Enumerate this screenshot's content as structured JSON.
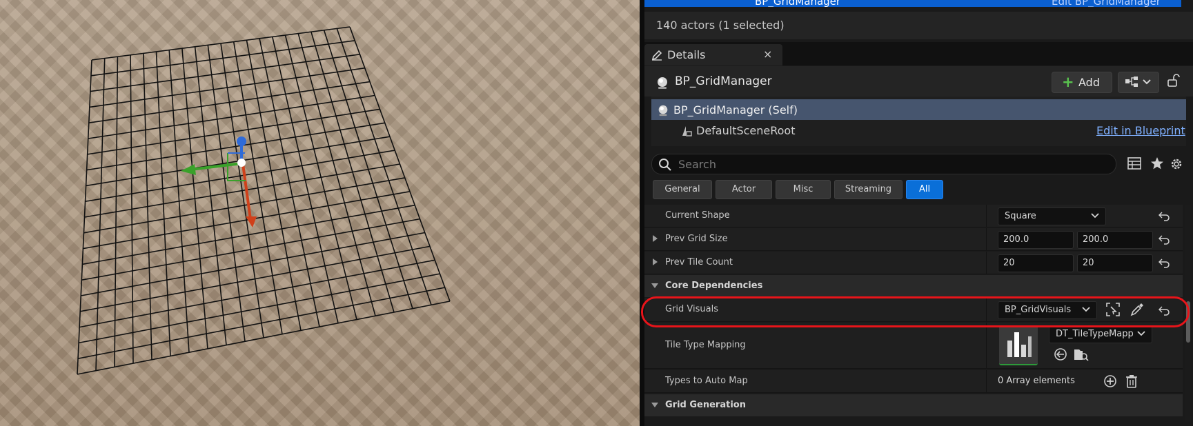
{
  "outliner": {
    "selected_actor": "BP_GridManager",
    "selected_edit": "Edit BP_GridManager",
    "actor_count": "140 actors (1 selected)"
  },
  "details": {
    "tab_label": "Details",
    "actor_name": "BP_GridManager",
    "add_label": "Add",
    "components": {
      "self": "BP_GridManager (Self)",
      "root": "DefaultSceneRoot",
      "edit_in_blueprint": "Edit in Blueprint"
    },
    "search_placeholder": "Search",
    "filters": [
      "General",
      "Actor",
      "Misc",
      "Streaming",
      "All"
    ],
    "active_filter": "All",
    "properties": {
      "current_shape": {
        "label": "Current Shape",
        "value": "Square"
      },
      "prev_grid_size": {
        "label": "Prev Grid Size",
        "x": "200.0",
        "y": "200.0"
      },
      "prev_tile_count": {
        "label": "Prev Tile Count",
        "x": "20",
        "y": "20"
      },
      "core_dependencies": "Core Dependencies",
      "grid_visuals": {
        "label": "Grid Visuals",
        "value": "BP_GridVisuals"
      },
      "tile_type_mapping": {
        "label": "Tile Type Mapping",
        "value": "DT_TileTypeMapp"
      },
      "types_to_auto_map": {
        "label": "Types to Auto Map",
        "value": "0 Array elements"
      },
      "grid_generation": "Grid Generation"
    }
  },
  "colors": {
    "highlight": "#e8141a",
    "active_filter": "#0a6fd8",
    "selection": "#0a5fd0",
    "add_plus": "#59c14e"
  }
}
